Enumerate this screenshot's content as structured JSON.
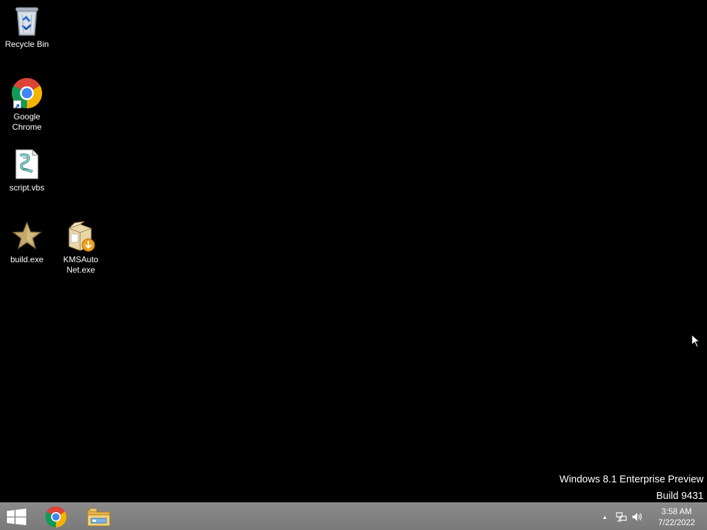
{
  "desktop": {
    "icons": [
      {
        "label": "Recycle Bin",
        "icon": "recycle-bin-icon"
      },
      {
        "label": "Google\nChrome",
        "icon": "chrome-icon"
      },
      {
        "label": "script.vbs",
        "icon": "vbs-script-icon"
      },
      {
        "label": "build.exe",
        "icon": "star-icon"
      },
      {
        "label": "KMSAuto\nNet.exe",
        "icon": "installer-box-icon"
      }
    ],
    "watermark": {
      "line1": "Windows 8.1 Enterprise Preview",
      "line2": "Build 9431"
    }
  },
  "taskbar": {
    "start_icon": "windows-logo-icon",
    "pinned": [
      {
        "name": "Google Chrome",
        "icon": "chrome-icon"
      },
      {
        "name": "File Explorer",
        "icon": "folder-icon"
      }
    ],
    "tray": {
      "overflow_glyph": "▲",
      "network_icon": "network-icon",
      "volume_icon": "speaker-icon"
    },
    "clock": {
      "time": "3:58 AM",
      "date": "7/22/2022"
    }
  },
  "colors": {
    "desktop_bg": "#000000",
    "taskbar_bg": "#808080",
    "chrome_red": "#DB4437",
    "chrome_green": "#0F9D58",
    "chrome_yellow": "#F4B400",
    "chrome_blue": "#4285F4"
  }
}
